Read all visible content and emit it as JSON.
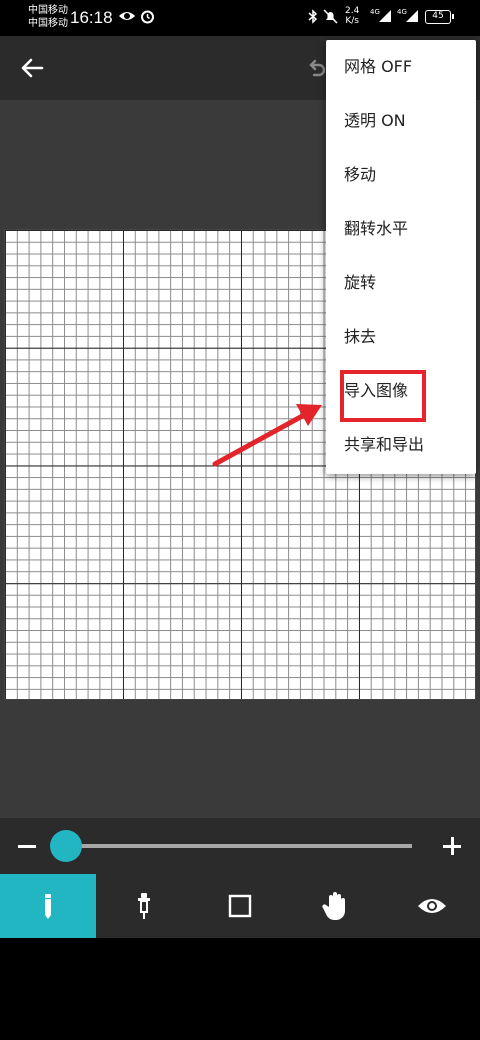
{
  "status_bar": {
    "carrier_1": "中国移动",
    "carrier_2": "中国移动",
    "time": "16:18",
    "net_speed_value": "2.4",
    "net_speed_unit": "K/s",
    "signal_1": "4G",
    "signal_2": "4G",
    "battery": "45"
  },
  "app_bar": {
    "back_icon": "arrow-left-icon",
    "undo_icon": "undo-icon"
  },
  "menu": {
    "items": [
      "网格 OFF",
      "透明 ON",
      "移动",
      "翻转水平",
      "旋转",
      "抹去",
      "导入图像",
      "共享和导出"
    ],
    "highlighted_item": "导入图像",
    "highlight_color": "#e3242b"
  },
  "slider": {
    "minus_icon": "minus-icon",
    "plus_icon": "plus-icon",
    "value_fraction": 0.0,
    "accent": "#22b5c2"
  },
  "toolbar": {
    "tools": [
      "pencil-icon",
      "eyedropper-icon",
      "square-icon",
      "hand-icon",
      "eye-icon"
    ],
    "active_tool": "pencil-icon",
    "active_color": "#22b5c2"
  },
  "annotation": {
    "arrow_color": "#e3242b"
  }
}
